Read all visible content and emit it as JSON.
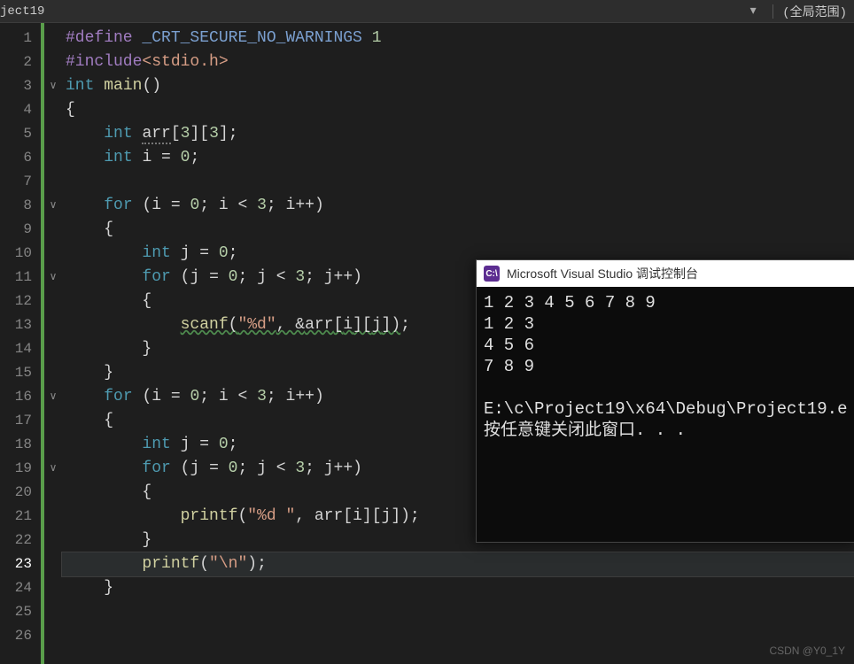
{
  "topbar": {
    "project": "ject19",
    "dropdown_glyph": "▾",
    "scope": "(全局范围)"
  },
  "gutter": {
    "start": 1,
    "end": 26,
    "current": 23
  },
  "fold": {
    "glyph": "∨",
    "lines": [
      3,
      8,
      11,
      16,
      19
    ]
  },
  "code_lines": [
    [
      [
        "mac",
        "#define "
      ],
      [
        "macname",
        "_CRT_SECURE_NO_WARNINGS"
      ],
      [
        "op",
        " "
      ],
      [
        "num",
        "1"
      ]
    ],
    [
      [
        "mac",
        "#include"
      ],
      [
        "hdr",
        "<stdio.h>"
      ]
    ],
    [
      [
        "kw",
        "int "
      ],
      [
        "main",
        "main"
      ],
      [
        "op",
        "()"
      ]
    ],
    [
      [
        "op",
        "{"
      ]
    ],
    [
      [
        "op",
        "    "
      ],
      [
        "kw",
        "int "
      ],
      [
        "id dotted",
        "arr"
      ],
      [
        "op",
        "["
      ],
      [
        "num",
        "3"
      ],
      [
        "op",
        "]["
      ],
      [
        "num",
        "3"
      ],
      [
        "op",
        "];"
      ]
    ],
    [
      [
        "op",
        "    "
      ],
      [
        "kw",
        "int "
      ],
      [
        "id",
        "i"
      ],
      [
        "op",
        " = "
      ],
      [
        "num",
        "0"
      ],
      [
        "op",
        ";"
      ]
    ],
    [
      [
        "op",
        ""
      ]
    ],
    [
      [
        "op",
        "    "
      ],
      [
        "kw",
        "for "
      ],
      [
        "op",
        "("
      ],
      [
        "id",
        "i"
      ],
      [
        "op",
        " = "
      ],
      [
        "num",
        "0"
      ],
      [
        "op",
        "; "
      ],
      [
        "id",
        "i"
      ],
      [
        "op",
        " < "
      ],
      [
        "num",
        "3"
      ],
      [
        "op",
        "; "
      ],
      [
        "id",
        "i"
      ],
      [
        "op",
        "++)"
      ]
    ],
    [
      [
        "op",
        "    {"
      ]
    ],
    [
      [
        "op",
        "        "
      ],
      [
        "kw",
        "int "
      ],
      [
        "id",
        "j"
      ],
      [
        "op",
        " = "
      ],
      [
        "num",
        "0"
      ],
      [
        "op",
        ";"
      ]
    ],
    [
      [
        "op",
        "        "
      ],
      [
        "kw",
        "for "
      ],
      [
        "op",
        "("
      ],
      [
        "id",
        "j"
      ],
      [
        "op",
        " = "
      ],
      [
        "num",
        "0"
      ],
      [
        "op",
        "; "
      ],
      [
        "id",
        "j"
      ],
      [
        "op",
        " < "
      ],
      [
        "num",
        "3"
      ],
      [
        "op",
        "; "
      ],
      [
        "id",
        "j"
      ],
      [
        "op",
        "++)"
      ]
    ],
    [
      [
        "op",
        "        {"
      ]
    ],
    [
      [
        "op",
        "            "
      ],
      [
        "fn wavy",
        "scanf"
      ],
      [
        "op wavy",
        "("
      ],
      [
        "str wavy",
        "\"%d\""
      ],
      [
        "op wavy",
        ", &"
      ],
      [
        "id wavy",
        "arr"
      ],
      [
        "op wavy",
        "["
      ],
      [
        "id wavy",
        "i"
      ],
      [
        "op wavy",
        "]["
      ],
      [
        "id wavy",
        "j"
      ],
      [
        "op wavy",
        "])"
      ],
      [
        "op",
        ";"
      ]
    ],
    [
      [
        "op",
        "        }"
      ]
    ],
    [
      [
        "op",
        "    }"
      ]
    ],
    [
      [
        "op",
        "    "
      ],
      [
        "kw",
        "for "
      ],
      [
        "op",
        "("
      ],
      [
        "id",
        "i"
      ],
      [
        "op",
        " = "
      ],
      [
        "num",
        "0"
      ],
      [
        "op",
        "; "
      ],
      [
        "id",
        "i"
      ],
      [
        "op",
        " < "
      ],
      [
        "num",
        "3"
      ],
      [
        "op",
        "; "
      ],
      [
        "id",
        "i"
      ],
      [
        "op",
        "++)"
      ]
    ],
    [
      [
        "op",
        "    {"
      ]
    ],
    [
      [
        "op",
        "        "
      ],
      [
        "kw",
        "int "
      ],
      [
        "id",
        "j"
      ],
      [
        "op",
        " = "
      ],
      [
        "num",
        "0"
      ],
      [
        "op",
        ";"
      ]
    ],
    [
      [
        "op",
        "        "
      ],
      [
        "kw",
        "for "
      ],
      [
        "op",
        "("
      ],
      [
        "id",
        "j"
      ],
      [
        "op",
        " = "
      ],
      [
        "num",
        "0"
      ],
      [
        "op",
        "; "
      ],
      [
        "id",
        "j"
      ],
      [
        "op",
        " < "
      ],
      [
        "num",
        "3"
      ],
      [
        "op",
        "; "
      ],
      [
        "id",
        "j"
      ],
      [
        "op",
        "++)"
      ]
    ],
    [
      [
        "op",
        "        {"
      ]
    ],
    [
      [
        "op",
        "            "
      ],
      [
        "fn",
        "printf"
      ],
      [
        "op",
        "("
      ],
      [
        "str",
        "\"%d \""
      ],
      [
        "op",
        ", "
      ],
      [
        "id",
        "arr"
      ],
      [
        "op",
        "["
      ],
      [
        "id",
        "i"
      ],
      [
        "op",
        "]["
      ],
      [
        "id",
        "j"
      ],
      [
        "op",
        "]);"
      ]
    ],
    [
      [
        "op",
        "        }"
      ]
    ],
    [
      [
        "op",
        "        "
      ],
      [
        "fn",
        "printf"
      ],
      [
        "op",
        "("
      ],
      [
        "str",
        "\"\\n\""
      ],
      [
        "op",
        ");"
      ]
    ],
    [
      [
        "op",
        "    }"
      ]
    ],
    [
      [
        "op",
        ""
      ]
    ],
    [
      [
        "op",
        ""
      ]
    ]
  ],
  "console": {
    "icon_text": "C:\\",
    "title": "Microsoft Visual Studio 调试控制台",
    "lines": [
      "1 2 3 4 5 6 7 8 9",
      "1 2 3",
      "4 5 6",
      "7 8 9",
      "",
      "E:\\c\\Project19\\x64\\Debug\\Project19.e",
      "按任意键关闭此窗口. . ."
    ]
  },
  "watermark": "CSDN @Y0_1Y"
}
